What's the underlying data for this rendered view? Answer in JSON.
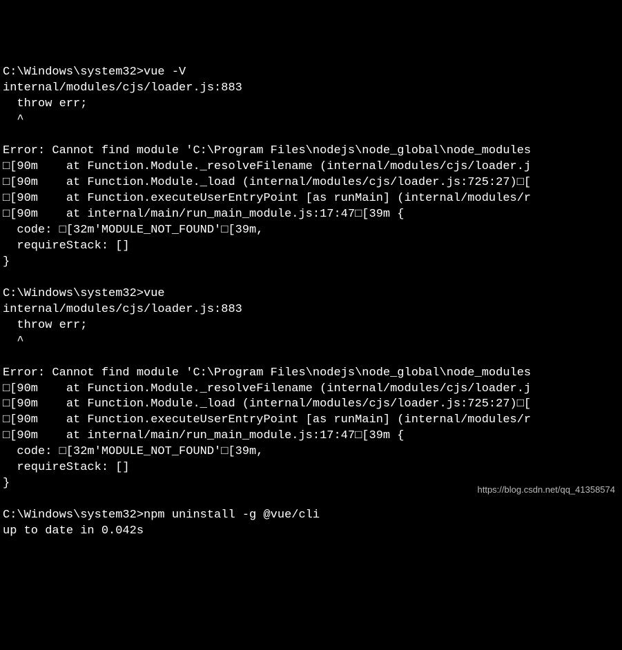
{
  "terminal": {
    "lines": [
      "C:\\Windows\\system32>vue -V",
      "internal/modules/cjs/loader.js:883",
      "  throw err;",
      "  ^",
      "",
      "Error: Cannot find module 'C:\\Program Files\\nodejs\\node_global\\node_modules",
      "□[90m    at Function.Module._resolveFilename (internal/modules/cjs/loader.j",
      "□[90m    at Function.Module._load (internal/modules/cjs/loader.js:725:27)□[",
      "□[90m    at Function.executeUserEntryPoint [as runMain] (internal/modules/r",
      "□[90m    at internal/main/run_main_module.js:17:47□[39m {",
      "  code: □[32m'MODULE_NOT_FOUND'□[39m,",
      "  requireStack: []",
      "}",
      "",
      "C:\\Windows\\system32>vue",
      "internal/modules/cjs/loader.js:883",
      "  throw err;",
      "  ^",
      "",
      "Error: Cannot find module 'C:\\Program Files\\nodejs\\node_global\\node_modules",
      "□[90m    at Function.Module._resolveFilename (internal/modules/cjs/loader.j",
      "□[90m    at Function.Module._load (internal/modules/cjs/loader.js:725:27)□[",
      "□[90m    at Function.executeUserEntryPoint [as runMain] (internal/modules/r",
      "□[90m    at internal/main/run_main_module.js:17:47□[39m {",
      "  code: □[32m'MODULE_NOT_FOUND'□[39m,",
      "  requireStack: []",
      "}",
      "",
      "C:\\Windows\\system32>npm uninstall -g @vue/cli",
      "up to date in 0.042s"
    ]
  },
  "watermark": {
    "text": "https://blog.csdn.net/qq_41358574"
  }
}
